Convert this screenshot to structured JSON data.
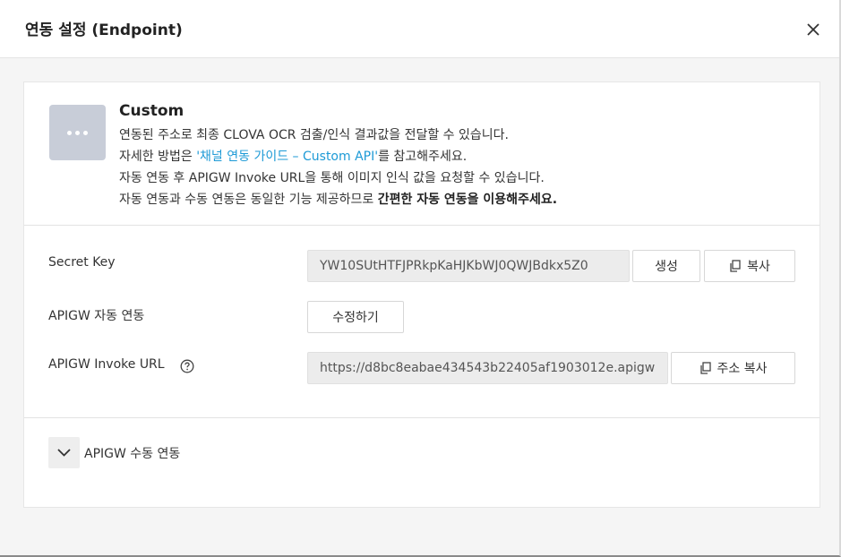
{
  "modal": {
    "title": "연동 설정 (Endpoint)",
    "close_icon": "close-icon"
  },
  "info": {
    "icon": "more-dots-icon",
    "title": "Custom",
    "line1": "연동된 주소로 최종 CLOVA OCR 검출/인식 결과값을 전달할 수 있습니다.",
    "line2_prefix": "자세한 방법은 ",
    "line2_link": "'채널 연동 가이드 – Custom API'",
    "line2_suffix": "를 참고해주세요.",
    "line3": "자동 연동 후 APIGW Invoke URL을 통해 이미지 인식 값을 요청할 수 있습니다.",
    "line4_prefix": "자동 연동과 수동 연동은 동일한 기능 제공하므로 ",
    "line4_bold": "간편한 자동 연동을 이용해주세요.",
    "link_color": "#1d9ad6"
  },
  "secret_key": {
    "label": "Secret Key",
    "value": "YW10SUtHTFJPRkpKaHJKbWJ0QWJBdkx5Z0",
    "generate_label": "생성",
    "copy_label": "복사"
  },
  "apigw_auto": {
    "label": "APIGW 자동 연동",
    "edit_label": "수정하기"
  },
  "invoke_url": {
    "label": "APIGW Invoke URL",
    "help_icon": "help-circle-icon",
    "value": "https://d8bc8eabae434543b22405af1903012e.apigw",
    "copy_label": "주소 복사"
  },
  "manual": {
    "toggle_icon": "chevron-down-icon",
    "label": "APIGW 수동 연동"
  }
}
